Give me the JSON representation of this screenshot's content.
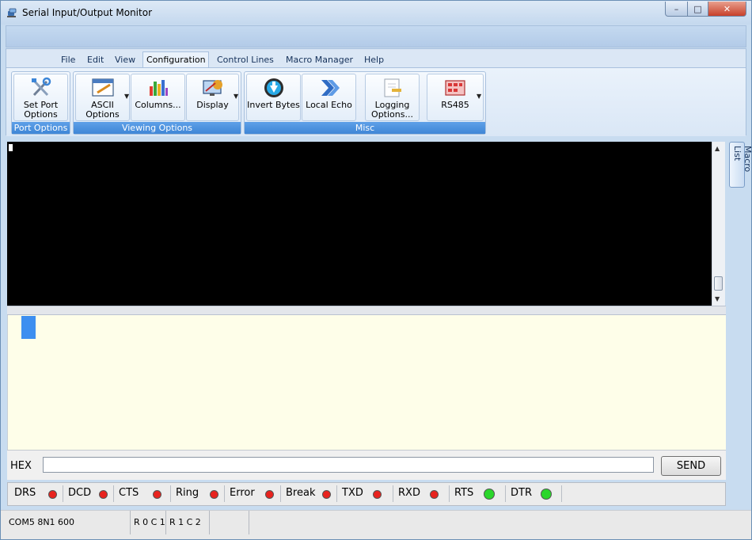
{
  "window": {
    "title": "Serial Input/Output Monitor",
    "controls": {
      "minimize": "–",
      "maximize": "□",
      "close": "✕"
    }
  },
  "menu": {
    "items": [
      "File",
      "Edit",
      "View",
      "Configuration",
      "Control Lines",
      "Macro Manager",
      "Help"
    ],
    "active": "Configuration"
  },
  "ribbon": {
    "groups": [
      {
        "label": "Port Options",
        "buttons": [
          {
            "label_line1": "Set Port",
            "label_line2": "Options",
            "icon": "tools-icon"
          }
        ]
      },
      {
        "label": "Viewing Options",
        "buttons": [
          {
            "label_line1": "ASCII",
            "label_line2": "Options",
            "icon": "edit-window-icon",
            "dropdown": true
          },
          {
            "label_line1": "Columns...",
            "label_line2": "",
            "icon": "columns-chart-icon"
          },
          {
            "label_line1": "Display",
            "label_line2": "",
            "icon": "display-icon",
            "dropdown": true
          }
        ]
      },
      {
        "label": "Misc",
        "buttons": [
          {
            "label_line1": "Invert Bytes",
            "label_line2": "",
            "icon": "down-arrow-icon"
          },
          {
            "label_line1": "Local Echo",
            "label_line2": "",
            "icon": "double-chevron-icon"
          },
          {
            "label_line1": "Logging",
            "label_line2": "Options...",
            "icon": "log-file-icon"
          },
          {
            "label_line1": "RS485",
            "label_line2": "",
            "icon": "rs485-icon",
            "dropdown": true
          }
        ]
      }
    ]
  },
  "side_tab": {
    "label": "Macro List"
  },
  "send": {
    "mode_label": "HEX",
    "input_value": "",
    "button_label": "SEND"
  },
  "leds": [
    {
      "label": "DRS",
      "state": "red"
    },
    {
      "label": "DCD",
      "state": "red"
    },
    {
      "label": "CTS",
      "state": "red"
    },
    {
      "label": "Ring",
      "state": "red"
    },
    {
      "label": "Error",
      "state": "red"
    },
    {
      "label": "Break",
      "state": "red"
    },
    {
      "label": "TXD",
      "state": "red"
    },
    {
      "label": "RXD",
      "state": "red"
    },
    {
      "label": "RTS",
      "state": "green"
    },
    {
      "label": "DTR",
      "state": "green"
    }
  ],
  "led_colors": {
    "red": "#e8231e",
    "green": "#2bd62b"
  },
  "statusbar": {
    "port": "COM5 8N1 600",
    "rx_pos": "R 0 C 1",
    "tx_pos": "R 1 C 2",
    "extra1": "",
    "extra2": ""
  }
}
